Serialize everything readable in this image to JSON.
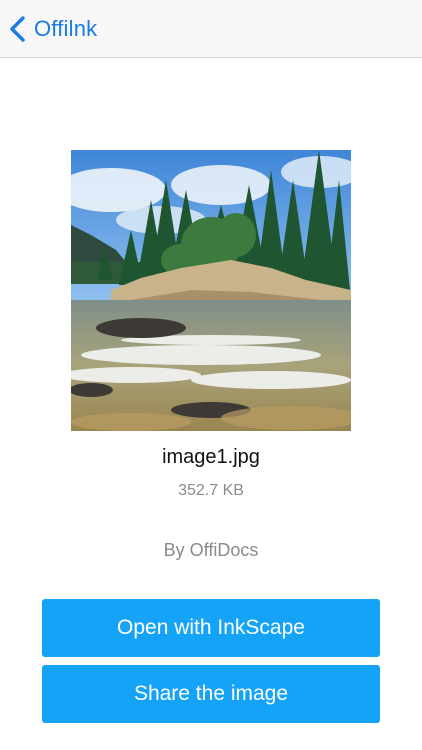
{
  "navbar": {
    "back_label": "Offilnk",
    "back_icon": "chevron-left-icon",
    "accent_color": "#1a7ae6"
  },
  "file": {
    "name": "image1.jpg",
    "size": "352.7 KB",
    "author": "By OffiDocs"
  },
  "actions": {
    "open_label": "Open with InkScape",
    "share_label": "Share the image",
    "button_color": "#15a3f7"
  }
}
